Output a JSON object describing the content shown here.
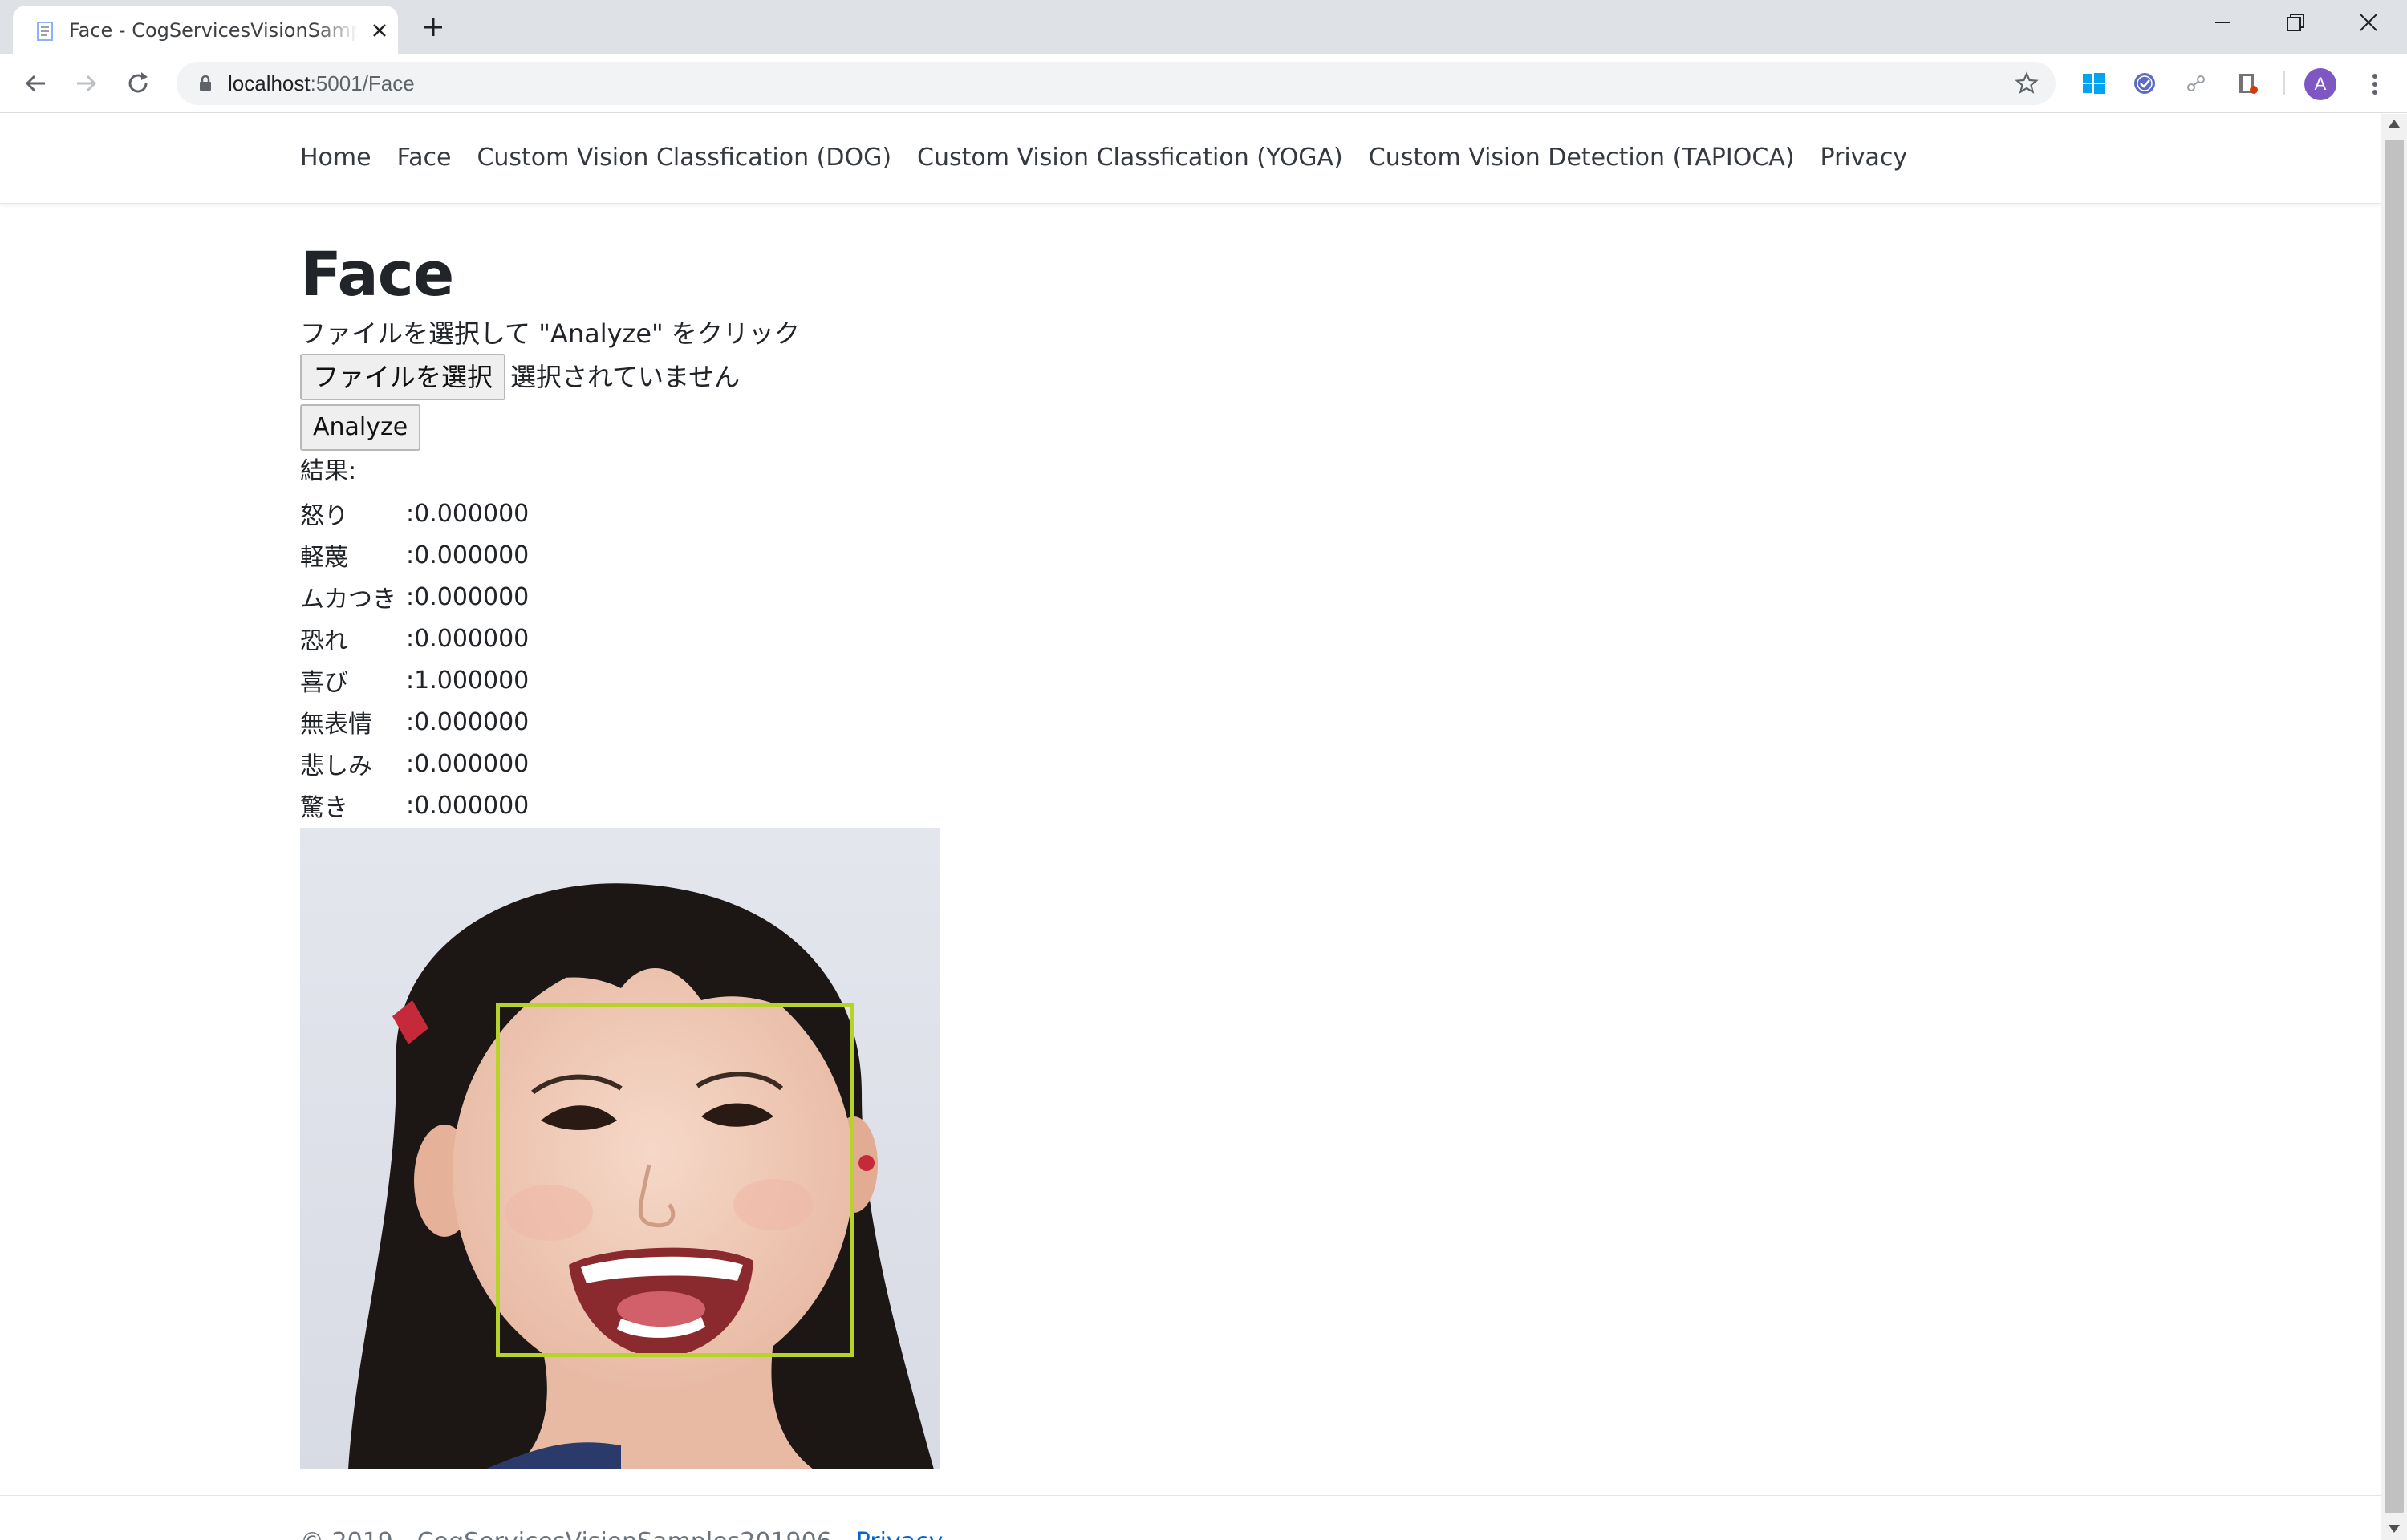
{
  "browser": {
    "tab_title": "Face - CogServicesVisionSamples",
    "url_host": "localhost",
    "url_path": ":5001/Face",
    "profile_initial": "A"
  },
  "nav": {
    "items": [
      {
        "label": "Home"
      },
      {
        "label": "Face"
      },
      {
        "label": "Custom Vision Classfication (DOG)"
      },
      {
        "label": "Custom Vision Classfication (YOGA)"
      },
      {
        "label": "Custom Vision Detection (TAPIOCA)"
      },
      {
        "label": "Privacy"
      }
    ]
  },
  "page": {
    "title": "Face",
    "instruction": "ファイルを選択して \"Analyze\" をクリック",
    "file_button": "ファイルを選択",
    "file_status": "選択されていません",
    "analyze_button": "Analyze",
    "result_label": "結果:"
  },
  "emotions": [
    {
      "name": "怒り",
      "value": ":0.000000"
    },
    {
      "name": "軽蔑",
      "value": ":0.000000"
    },
    {
      "name": "ムカつき",
      "value": ":0.000000"
    },
    {
      "name": "恐れ",
      "value": ":0.000000"
    },
    {
      "name": "喜び",
      "value": ":1.000000"
    },
    {
      "name": "無表情",
      "value": ":0.000000"
    },
    {
      "name": "悲しみ",
      "value": ":0.000000"
    },
    {
      "name": "驚き",
      "value": ":0.000000"
    }
  ],
  "footer": {
    "text": "© 2019 - CogServicesVisionSamples201906 - ",
    "link": "Privacy"
  },
  "colors": {
    "face_box": "#b5d32a",
    "avatar": "#7e57c2"
  }
}
